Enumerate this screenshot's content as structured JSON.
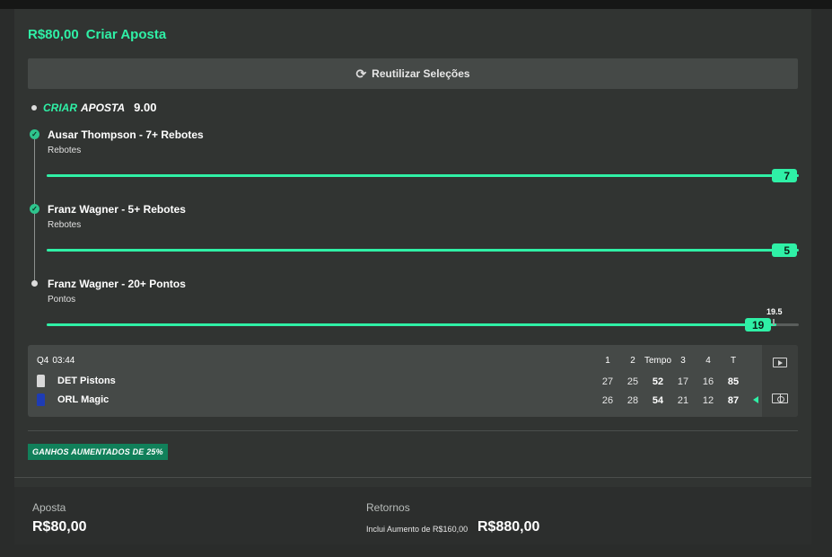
{
  "header": {
    "stake": "R$80,00",
    "title": "Criar Aposta"
  },
  "reuse_button": {
    "icon": "refresh-icon",
    "label": "Reutilizar Seleções"
  },
  "bet_builder": {
    "label_accent": "CRIAR",
    "label_rest": "APOSTA",
    "odds": "9.00"
  },
  "legs": [
    {
      "name": "Ausar Thompson - 7+ Rebotes",
      "market": "Rebotes",
      "current": "7",
      "progress": 1.0,
      "status": "won"
    },
    {
      "name": "Franz Wagner - 5+ Rebotes",
      "market": "Rebotes",
      "current": "5",
      "progress": 1.0,
      "status": "won"
    },
    {
      "name": "Franz Wagner - 20+ Pontos",
      "market": "Pontos",
      "current": "19",
      "target": "19.5",
      "progress": 0.97,
      "status": "pending"
    }
  ],
  "scoreboard": {
    "period": "Q4",
    "clock": "03:44",
    "columns": [
      "1",
      "2",
      "Tempo",
      "3",
      "4",
      "T"
    ],
    "teams": [
      {
        "name": "DET Pistons",
        "scores": [
          "27",
          "25",
          "52",
          "17",
          "16",
          "85"
        ],
        "jersey_color": "#d8d8d8"
      },
      {
        "name": "ORL Magic",
        "scores": [
          "26",
          "28",
          "54",
          "21",
          "12",
          "87"
        ],
        "jersey_color": "#1e3cb5",
        "possession": true
      }
    ],
    "side_icons": [
      "play-video-icon",
      "court-view-icon"
    ]
  },
  "boost_badge": "GANHOS AUMENTADOS DE 25%",
  "footer": {
    "stake_label": "Aposta",
    "stake_value": "R$80,00",
    "returns_label": "Retornos",
    "returns_note": "Inclui Aumento de R$160,00",
    "returns_value": "R$880,00"
  },
  "colors": {
    "accent": "#2ff0a6",
    "boost": "#11805a",
    "background": "#313432"
  }
}
